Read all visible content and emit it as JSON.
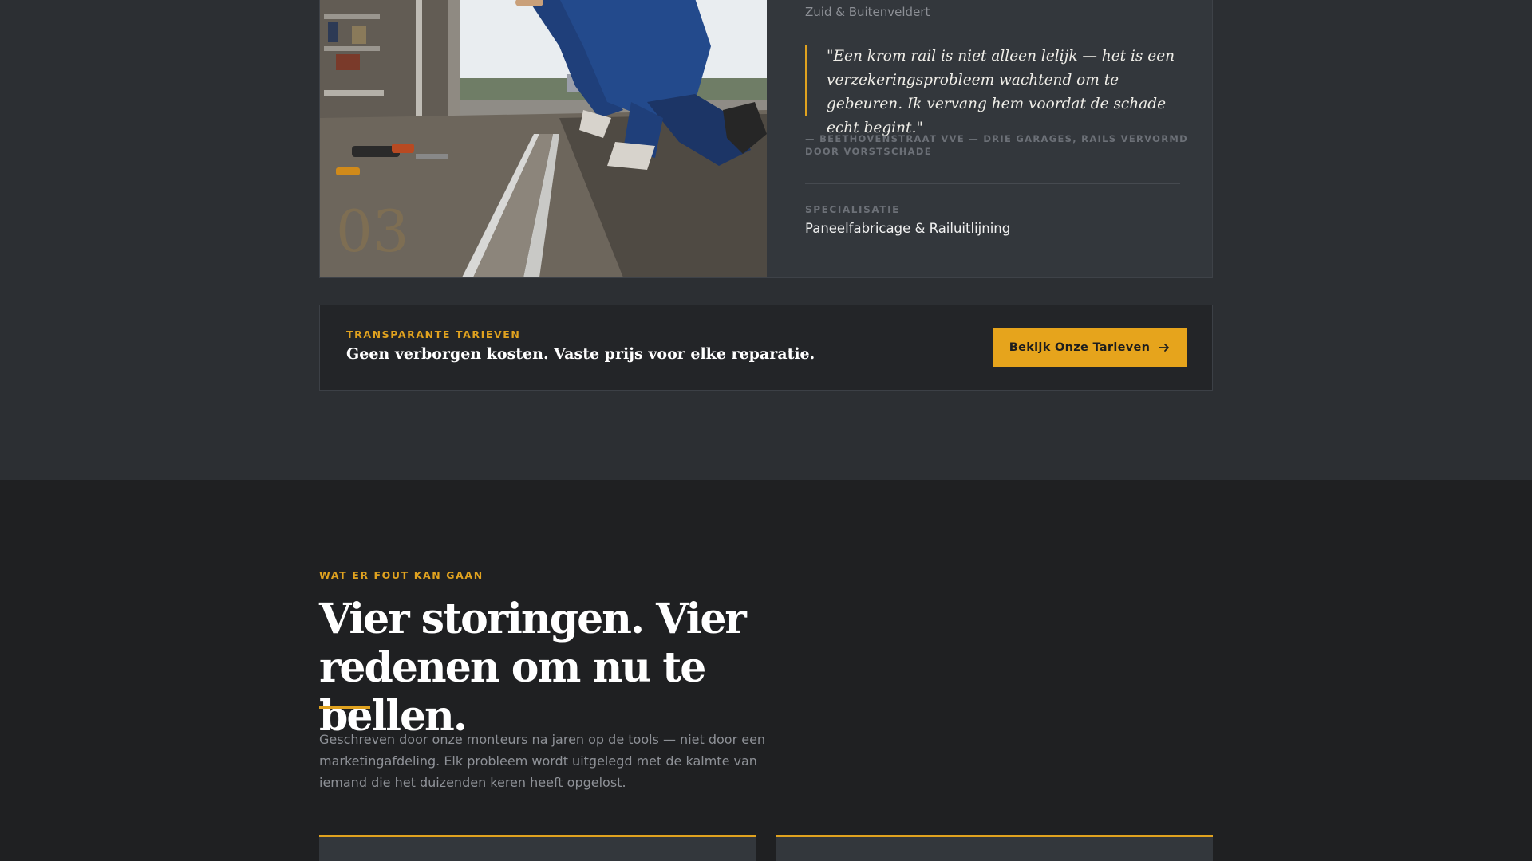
{
  "profile": {
    "photo_number": "03",
    "area": "Zuid & Buitenveldert",
    "quote": "\"Een krom rail is niet alleen lelijk — het is een verzekeringsprobleem wachtend om te gebeuren. Ik vervang hem voordat de schade echt begint.\"",
    "attribution": "— Beethovenstraat VvE — drie garages, rails vervormd door vorstschade",
    "spec_label": "SPECIALISATIE",
    "spec_value": "Paneelfabricage & Railuitlijning"
  },
  "pricing": {
    "eyebrow": "TRANSPARANTE TARIEVEN",
    "text": "Geen verborgen kosten. Vaste prijs voor elke reparatie.",
    "button_label": "Bekijk Onze Tarieven",
    "button_icon": "arrow-right-icon"
  },
  "issues_section": {
    "eyebrow": "WAT ER FOUT KAN GAAN",
    "headline": "Vier storingen. Vier redenen om nu te bellen.",
    "intro": "Geschreven door onze monteurs na jaren op de tools — niet door een marketingafdeling. Elk probleem wordt uitgelegd met de kalmte van iemand die het duizenden keren heeft opgelost."
  },
  "colors": {
    "accent": "#e0a21f",
    "button": "#e6a41c",
    "background_upper": "#2c2f33",
    "background_lower": "#1f2022",
    "card": "#33373c"
  }
}
